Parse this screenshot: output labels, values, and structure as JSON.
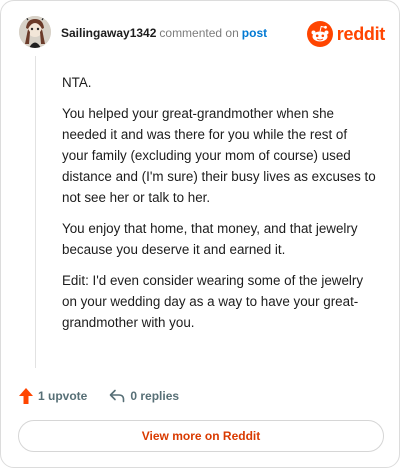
{
  "header": {
    "username": "Sailingaway1342",
    "action_text": "commented on",
    "post_link": "post",
    "brand": "reddit"
  },
  "comment": {
    "paragraphs": [
      "NTA.",
      "You helped your great-grandmother when she needed it and was there for you while the rest of your family (excluding your mom of course) used distance and (I'm sure) their busy lives as excuses to not see her or talk to her.",
      "You enjoy that home, that money, and that jewelry because you deserve it and earned it.",
      "Edit: I'd even consider wearing some of the jewelry on your wedding day as a way to have your great-grandmother with you."
    ]
  },
  "actions": {
    "upvote_label": "1 upvote",
    "replies_label": "0 replies"
  },
  "footer": {
    "view_more_label": "View more on Reddit"
  },
  "colors": {
    "brand": "#ff4500",
    "link": "#0079d3",
    "view_more_text": "#d93a00"
  },
  "icons": {
    "avatar": "user-avatar",
    "brand": "reddit-logo-icon",
    "upvote": "upvote-arrow-icon",
    "reply": "reply-arrow-icon"
  }
}
